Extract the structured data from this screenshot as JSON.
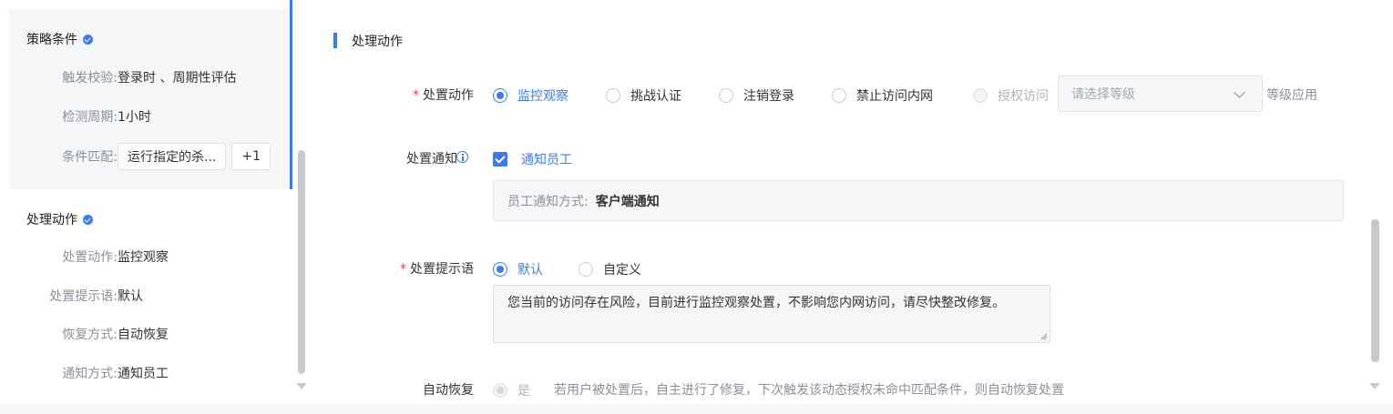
{
  "summary": {
    "condition": {
      "title": "策略条件",
      "trigger_key": "触发校验:",
      "trigger_value": "登录时 、周期性评估",
      "period_key": "检测周期:",
      "period_value": "1小时",
      "match_key": "条件匹配:",
      "match_tag": "运行指定的杀...",
      "match_more": "+1"
    },
    "action": {
      "title": "处理动作",
      "action_key": "处置动作:",
      "action_value": "监控观察",
      "prompt_key": "处置提示语:",
      "prompt_value": "默认",
      "recover_key": "恢复方式:",
      "recover_value": "自动恢复",
      "notify_key": "通知方式:",
      "notify_value": "通知员工"
    }
  },
  "form": {
    "section_title": "处理动作",
    "required_mark": "*",
    "action": {
      "label": "处置动作",
      "options": [
        "监控观察",
        "挑战认证",
        "注销登录",
        "禁止访问内网",
        "授权访问"
      ],
      "selected": "监控观察",
      "level_placeholder": "请选择等级",
      "level_suffix": "等级应用"
    },
    "notification": {
      "label": "处置通知",
      "checkbox_label": "通知员工",
      "checked": true,
      "method_key": "员工通知方式:",
      "method_value": "客户端通知"
    },
    "prompt": {
      "label": "处置提示语",
      "options": [
        "默认",
        "自定义"
      ],
      "selected": "默认",
      "text": "您当前的访问存在风险，目前进行监控观察处置，不影响您内网访问，请尽快整改修复。"
    },
    "auto_recover": {
      "label": "自动恢复",
      "option": "是",
      "hint": "若用户被处置后，自主进行了修复，下次触发该动态授权未命中匹配条件，则自动恢复处置"
    }
  },
  "colors": {
    "accent": "#3a7bf5",
    "required": "#f04040",
    "panel_bg": "#f5f6f8"
  }
}
